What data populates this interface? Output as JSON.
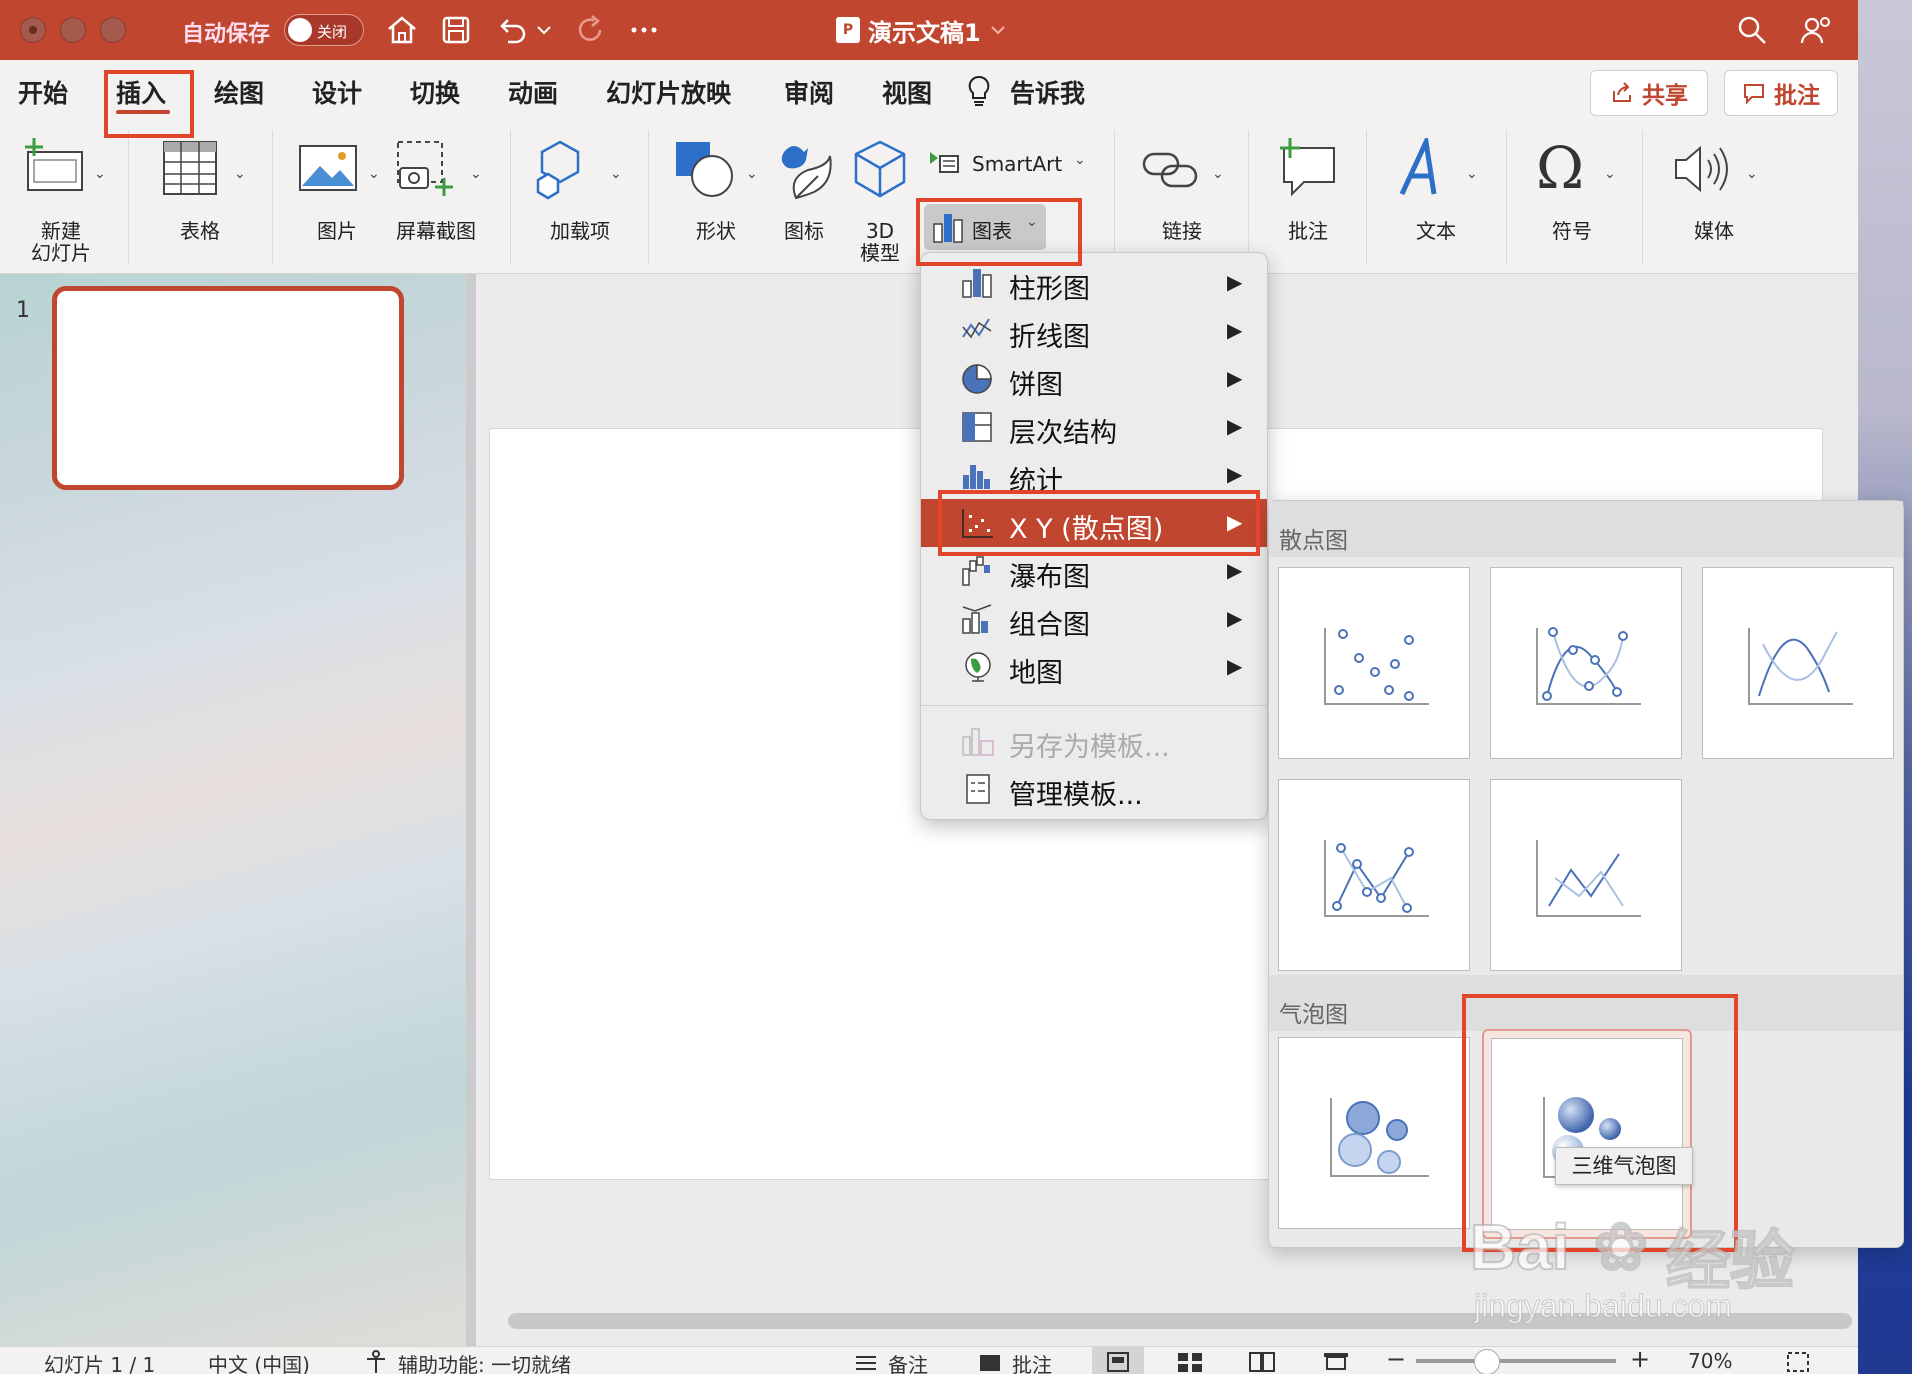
{
  "titlebar": {
    "autosave_label": "自动保存",
    "autosave_state": "关闭",
    "doc_title": "演示文稿1",
    "app_badge": "P"
  },
  "tabs": [
    "开始",
    "插入",
    "绘图",
    "设计",
    "切换",
    "动画",
    "幻灯片放映",
    "审阅",
    "视图",
    "告诉我"
  ],
  "active_tab": "插入",
  "actions": {
    "share": "共享",
    "comment": "批注"
  },
  "ribbon": {
    "new_slide": "新建\n幻灯片",
    "new_slide_line1": "新建",
    "new_slide_line2": "幻灯片",
    "table": "表格",
    "picture": "图片",
    "screenshot": "屏幕截图",
    "addins": "加载项",
    "shapes": "形状",
    "icons": "图标",
    "model3d_line1": "3D",
    "model3d_line2": "模型",
    "smartart": "SmartArt",
    "chart": "图表",
    "link": "链接",
    "comment": "批注",
    "text": "文本",
    "symbol": "符号",
    "media": "媒体"
  },
  "thumbnails": {
    "slide_number": "1"
  },
  "chart_menu": {
    "items": [
      {
        "label": "柱形图",
        "icon": "column-chart-icon"
      },
      {
        "label": "折线图",
        "icon": "line-chart-icon"
      },
      {
        "label": "饼图",
        "icon": "pie-chart-icon"
      },
      {
        "label": "层次结构",
        "icon": "hierarchy-chart-icon"
      },
      {
        "label": "统计",
        "icon": "statistic-chart-icon"
      },
      {
        "label": "X Y (散点图)",
        "icon": "scatter-chart-icon"
      },
      {
        "label": "瀑布图",
        "icon": "waterfall-chart-icon"
      },
      {
        "label": "组合图",
        "icon": "combo-chart-icon"
      },
      {
        "label": "地图",
        "icon": "map-chart-icon"
      }
    ],
    "save_template": "另存为模板...",
    "manage_templates": "管理模板..."
  },
  "gallery": {
    "scatter_header": "散点图",
    "bubble_header": "气泡图",
    "tooltip": "三维气泡图"
  },
  "statusbar": {
    "slide_info": "幻灯片 1 / 1",
    "language": "中文 (中国)",
    "accessibility": "辅助功能: 一切就绪",
    "notes": "备注",
    "comments": "批注",
    "zoom": "70%"
  },
  "watermark": {
    "text1": "Bai",
    "text2": "经验",
    "text3": "jingyan.baidu.com"
  },
  "colors": {
    "accent": "#c1462f",
    "highlight_box": "#e2452b",
    "chart_blue": "#4a72b8"
  }
}
